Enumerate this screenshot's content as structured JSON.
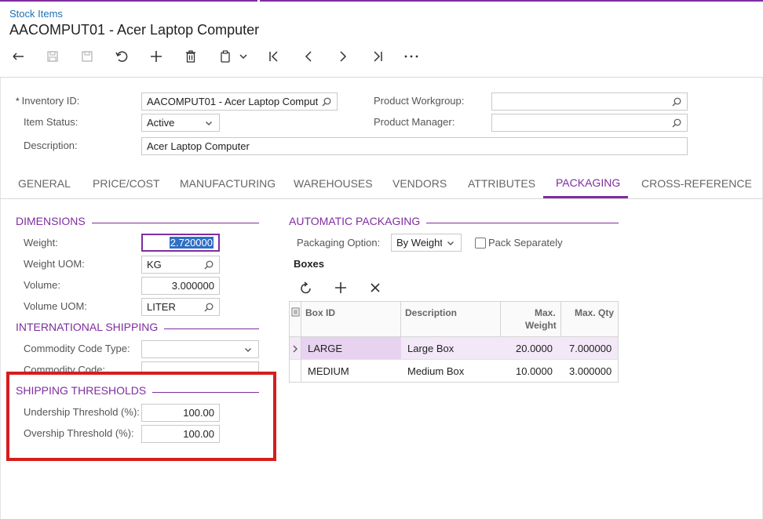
{
  "header": {
    "breadcrumb": "Stock Items",
    "title": "AACOMPUT01 - Acer Laptop Computer"
  },
  "toolbar": {
    "icons": [
      "back-icon",
      "save-close-icon",
      "save-icon",
      "undo-icon",
      "add-icon",
      "delete-icon",
      "copy-paste-icon",
      "chevron-down-icon",
      "first-record-icon",
      "previous-icon",
      "next-icon",
      "last-record-icon",
      "more-icon"
    ]
  },
  "summary": {
    "inventory_id_label": "Inventory ID:",
    "inventory_id_required": "*",
    "inventory_id_value": "AACOMPUT01 - Acer Laptop Computer",
    "item_status_label": "Item Status:",
    "item_status_value": "Active",
    "description_label": "Description:",
    "description_value": "Acer Laptop Computer",
    "product_workgroup_label": "Product Workgroup:",
    "product_workgroup_value": "",
    "product_manager_label": "Product Manager:",
    "product_manager_value": ""
  },
  "tabs": [
    "GENERAL",
    "PRICE/COST",
    "MANUFACTURING",
    "WAREHOUSES",
    "VENDORS",
    "ATTRIBUTES",
    "PACKAGING",
    "CROSS-REFERENCE"
  ],
  "active_tab": "PACKAGING",
  "dimensions": {
    "title": "DIMENSIONS",
    "weight_label": "Weight:",
    "weight_value": "2.720000",
    "weight_uom_label": "Weight UOM:",
    "weight_uom_value": "KG",
    "volume_label": "Volume:",
    "volume_value": "3.000000",
    "volume_uom_label": "Volume UOM:",
    "volume_uom_value": "LITER"
  },
  "international": {
    "title": "INTERNATIONAL SHIPPING",
    "commodity_type_label": "Commodity Code Type:",
    "commodity_type_value": "",
    "commodity_code_label": "Commodity Code:",
    "commodity_code_value": ""
  },
  "thresholds": {
    "title": "SHIPPING THRESHOLDS",
    "undership_label": "Undership Threshold (%):",
    "undership_value": "100.00",
    "overship_label": "Overship Threshold (%):",
    "overship_value": "100.00"
  },
  "auto_packaging": {
    "title": "AUTOMATIC PACKAGING",
    "option_label": "Packaging Option:",
    "option_value": "By Weight",
    "pack_separately_label": "Pack Separately",
    "pack_separately_checked": false,
    "boxes_label": "Boxes"
  },
  "boxes_grid": {
    "headers": {
      "box_id": "Box ID",
      "description": "Description",
      "max_weight_1": "Max.",
      "max_weight_2": "Weight",
      "max_qty": "Max. Qty"
    },
    "rows": [
      {
        "box_id": "LARGE",
        "description": "Large Box",
        "max_weight": "20.0000",
        "max_qty": "7.000000",
        "selected": true
      },
      {
        "box_id": "MEDIUM",
        "description": "Medium Box",
        "max_weight": "10.0000",
        "max_qty": "3.000000",
        "selected": false
      }
    ]
  },
  "colors": {
    "accent": "#7e2da0",
    "link": "#1f6fb2",
    "highlight_box": "#d61d1d",
    "selected_row": "#f3e8f7"
  }
}
